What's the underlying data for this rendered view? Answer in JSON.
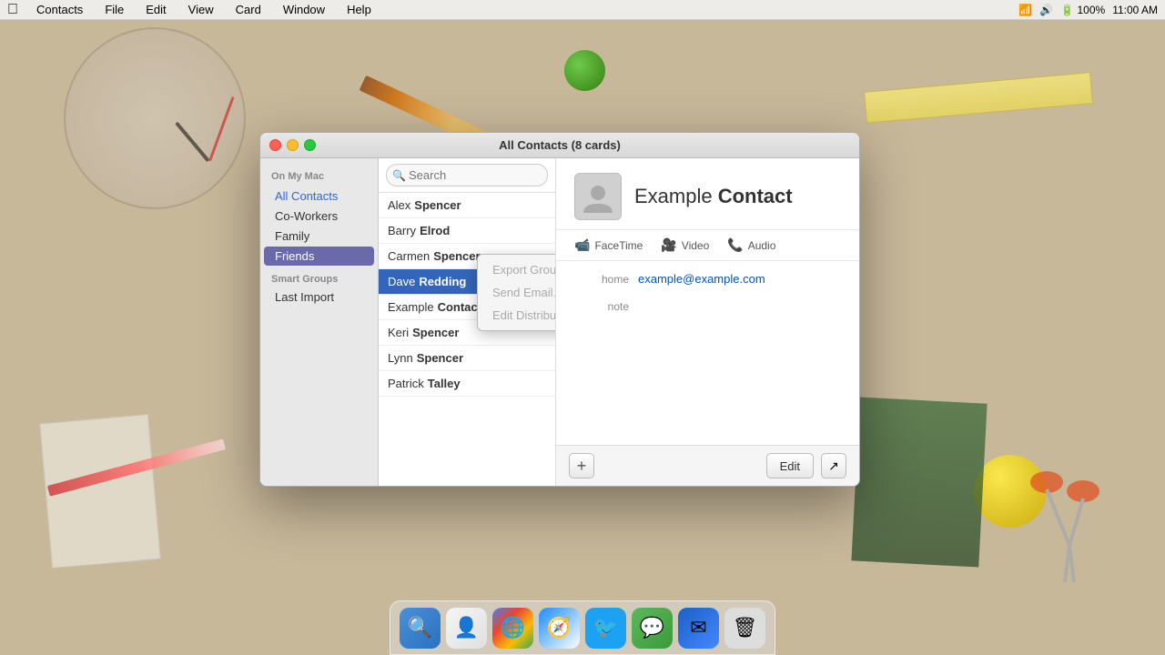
{
  "menubar": {
    "apple": "⌘",
    "items": [
      "Contacts",
      "File",
      "Edit",
      "View",
      "Card",
      "Window",
      "Help"
    ],
    "right_items": [
      "📺",
      "🔊",
      "🔋",
      "100%",
      "11:00 AM"
    ]
  },
  "window": {
    "title": "All Contacts (8 cards)",
    "traffic_lights": {
      "close": "close",
      "minimize": "minimize",
      "maximize": "maximize"
    }
  },
  "sidebar": {
    "on_my_mac_label": "On My Mac",
    "items": [
      {
        "id": "all-contacts",
        "label": "All Contacts",
        "active": false,
        "special": true
      },
      {
        "id": "co-workers",
        "label": "Co-Workers",
        "active": false
      },
      {
        "id": "family",
        "label": "Family",
        "active": false
      },
      {
        "id": "friends",
        "label": "Friends",
        "active": true
      }
    ],
    "smart_groups_label": "Smart Groups",
    "smart_items": [
      {
        "id": "last-import",
        "label": "Last Import",
        "active": false
      }
    ]
  },
  "search": {
    "placeholder": "Search"
  },
  "contacts": [
    {
      "first": "Alex",
      "last": "Spencer",
      "selected": false
    },
    {
      "first": "Barry",
      "last": "Elrod",
      "selected": false
    },
    {
      "first": "Carmen",
      "last": "Spencer",
      "selected": false
    },
    {
      "first": "Dave",
      "last": "Redding",
      "selected": true
    },
    {
      "first": "Example",
      "last": "Contact",
      "selected": false
    },
    {
      "first": "Keri",
      "last": "Spencer",
      "selected": false
    },
    {
      "first": "Lynn",
      "last": "Spencer",
      "selected": false
    },
    {
      "first": "Patrick",
      "last": "Talley",
      "selected": false
    }
  ],
  "context_menu": {
    "items": [
      {
        "label": "Export Group…",
        "disabled": true
      },
      {
        "label": "Send Email…",
        "disabled": true
      },
      {
        "label": "Edit Distribution List…",
        "disabled": true
      }
    ]
  },
  "detail": {
    "contact_name_first": "Example",
    "contact_name_last": "Contact",
    "facetime_label": "FaceTime",
    "video_label": "Video",
    "audio_label": "Audio",
    "email_label": "home",
    "email_value": "example@example.com",
    "note_label": "note",
    "note_value": ""
  },
  "footer": {
    "add_label": "+",
    "edit_label": "Edit",
    "share_label": "↗"
  },
  "dock": {
    "icons": [
      {
        "id": "finder",
        "emoji": "🔍",
        "color": "#4a90d9"
      },
      {
        "id": "contacts",
        "emoji": "👤",
        "color": "#f0f0f0"
      },
      {
        "id": "chrome",
        "emoji": "🌐",
        "color": "#4285f4"
      },
      {
        "id": "safari",
        "emoji": "🧭",
        "color": "#1a8cff"
      },
      {
        "id": "twitter",
        "emoji": "🐦",
        "color": "#1da1f2"
      },
      {
        "id": "messages",
        "emoji": "💬",
        "color": "#5cb85c"
      },
      {
        "id": "mail",
        "emoji": "✉",
        "color": "#1a5fc8"
      },
      {
        "id": "trash",
        "emoji": "🗑",
        "color": "#ddd"
      }
    ]
  }
}
